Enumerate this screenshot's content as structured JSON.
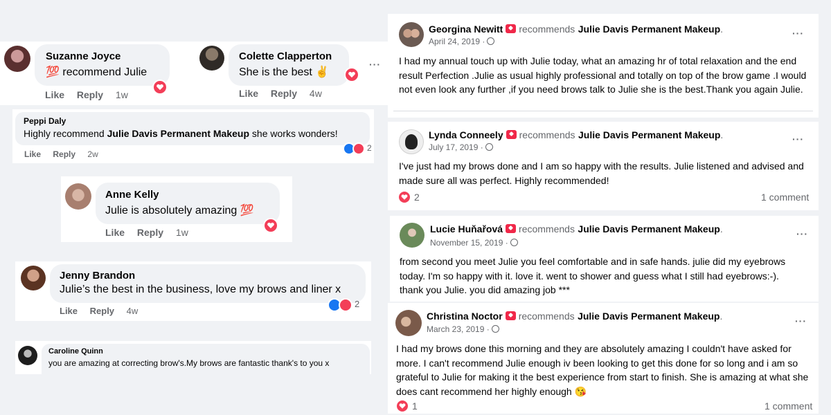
{
  "comments": [
    {
      "name": "Suzanne Joyce",
      "text": "💯 recommend Julie",
      "like": "Like",
      "reply": "Reply",
      "time": "1w"
    },
    {
      "name": "Colette Clapperton",
      "text": "She is the best ✌",
      "like": "Like",
      "reply": "Reply",
      "time": "4w"
    },
    {
      "name": "Peppi Daly",
      "text_pre": "Highly recommend ",
      "text_bold": "Julie Davis Permanent Makeup",
      "text_post": " she works wonders!",
      "like": "Like",
      "reply": "Reply",
      "time": "2w",
      "reaction_count": "2"
    },
    {
      "name": "Anne Kelly",
      "text": "Julie is absolutely amazing 💯",
      "like": "Like",
      "reply": "Reply",
      "time": "1w"
    },
    {
      "name": "Jenny Brandon",
      "text": "Julie’s the best in the business, love my brows and liner x",
      "like": "Like",
      "reply": "Reply",
      "time": "4w",
      "reaction_count": "2"
    },
    {
      "name": "Caroline Quinn",
      "text": "you are amazing at correcting brow's.My brows are fantastic thank's to you x"
    }
  ],
  "reviews": [
    {
      "name": "Georgina Newitt",
      "recommends": "recommends",
      "page": "Julie Davis Permanent Makeup",
      "date": "April 24, 2019 ·",
      "body": "I had my annual touch up with Julie today, what an amazing hr of total relaxation   and the end result Perfection .Julie as usual highly professional and totally on top of the brow game .I would not even look any further ,if you need brows talk to Julie she is the best.Thank you again Julie."
    },
    {
      "name": "Lynda Conneely",
      "recommends": "recommends",
      "page": "Julie Davis Permanent Makeup",
      "date": "July 17, 2019 ·",
      "body": "I've just had my brows done and I am so happy with the results. Julie listened and advised and made sure all was perfect. Highly recommended!",
      "reactions": "2",
      "comments": "1 comment"
    },
    {
      "name": "Lucie Huňařová",
      "recommends": "recommends",
      "page": "Julie Davis Permanent Makeup",
      "date": "November 15, 2019 ·",
      "body": "from second you meet Julie you feel comfortable and in safe hands. julie did my eyebrows today. I'm so happy with it. love it. went to shower and guess what I still had eyebrows:-). thank you Julie. you did amazing job ***"
    },
    {
      "name": "Christina Noctor",
      "recommends": "recommends",
      "page": "Julie Davis Permanent Makeup",
      "date": "March 23, 2019 ·",
      "body": "I had my brows done this morning and they are absolutely amazing I couldn't have asked for more. I can't recommend Julie enough iv been looking to get this done for so long and i am so grateful to Julie for making it the best experience from start to finish. She is amazing at what she does cant recommend her highly enough 😘",
      "reactions": "1",
      "comments": "1 comment"
    }
  ],
  "more_label": "···",
  "colors": {
    "background": "#f0f2f5",
    "heart": "#f33e58",
    "like": "#1877f2",
    "badge": "#f02849"
  }
}
